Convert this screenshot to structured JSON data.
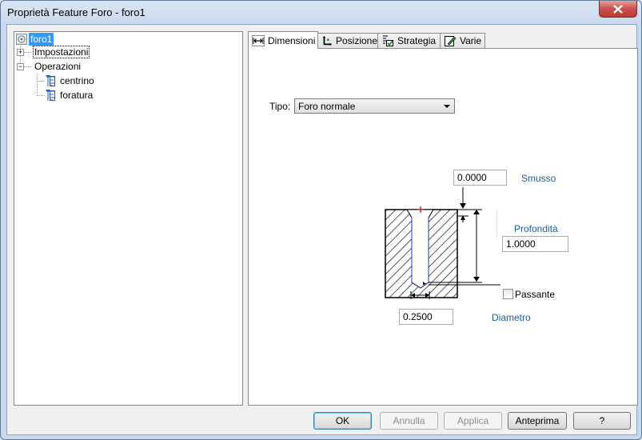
{
  "window": {
    "title": "Proprietà Feature Foro - foro1"
  },
  "tree": {
    "root": "foro1",
    "impostazioni": "Impostazioni",
    "operazioni": "Operazioni",
    "ops": [
      "centrino",
      "foratura"
    ]
  },
  "tabs": [
    "Dimensioni",
    "Posizione",
    "Strategia",
    "Varie"
  ],
  "tipo": {
    "label": "Tipo:",
    "value": "Foro normale"
  },
  "fields": {
    "smusso_value": "0.0000",
    "smusso_label": "Smusso",
    "profondita_label": "Profondità",
    "profondita_value": "1.0000",
    "passante_label": "Passante",
    "diametro_value": "0.2500",
    "diametro_label": "Diametro"
  },
  "buttons": {
    "ok": "OK",
    "annulla": "Annulla",
    "applica": "Applica",
    "anteprima": "Anteprima",
    "help": "?"
  },
  "colors": {
    "selection": "#3399ff",
    "label_blue": "#1a5ca8",
    "close_red": "#c75050"
  }
}
